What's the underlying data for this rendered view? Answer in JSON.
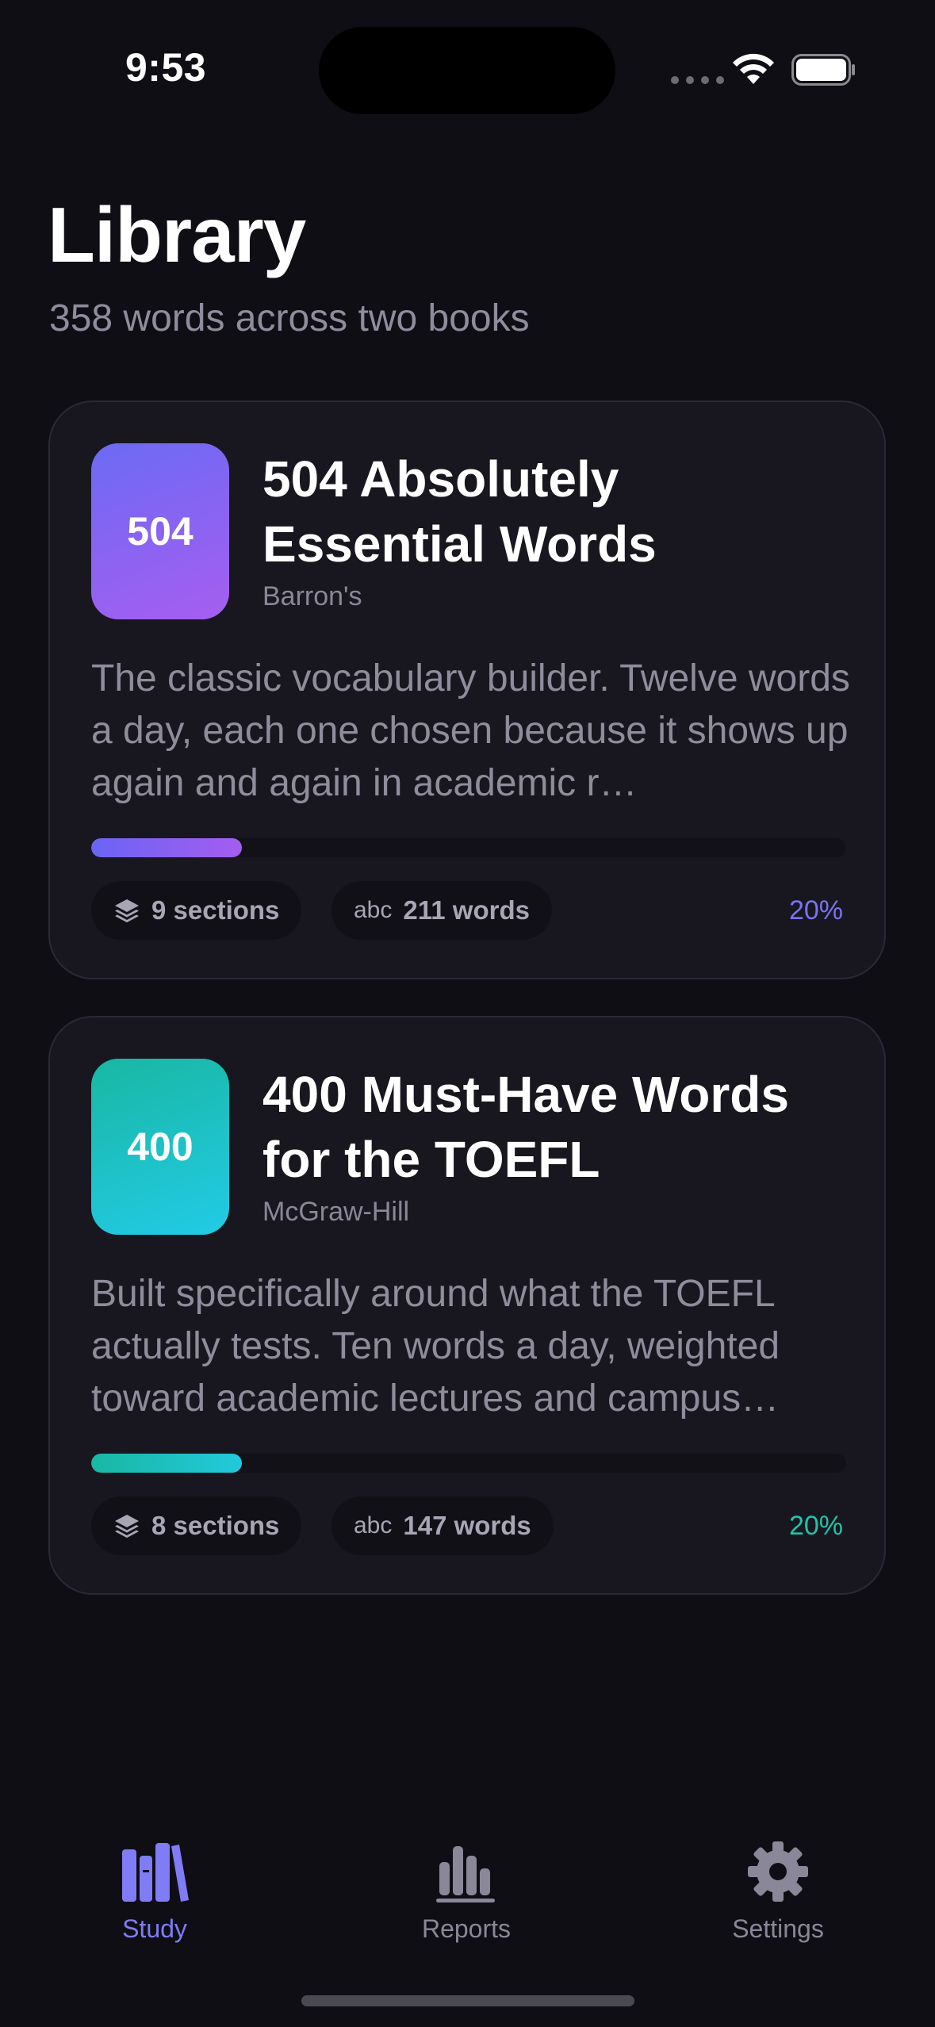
{
  "status_bar": {
    "time": "9:53"
  },
  "header": {
    "title": "Library",
    "subtitle": "358 words across two books"
  },
  "books": [
    {
      "cover_label": "504",
      "title": "504 Absolutely Essential Words",
      "publisher": "Barron's",
      "description": "The classic vocabulary builder. Twelve words a day, each one chosen because it shows up again and again in academic r…",
      "progress": 0.2,
      "progress_label": "20%",
      "sections_label": "9 sections",
      "words_prefix": "abc",
      "words_label": "211 words",
      "accent": "#7b72f5"
    },
    {
      "cover_label": "400",
      "title": "400 Must-Have Words for the TOEFL",
      "publisher": "McGraw-Hill",
      "description": "Built specifically around what the TOEFL actually tests. Ten words a day, weighted toward academic lectures and campus…",
      "progress": 0.2,
      "progress_label": "20%",
      "sections_label": "8 sections",
      "words_prefix": "abc",
      "words_label": "147 words",
      "accent": "#22c3a8"
    }
  ],
  "tab_bar": {
    "items": [
      {
        "label": "Study",
        "icon": "books-icon",
        "active": true
      },
      {
        "label": "Reports",
        "icon": "bar-chart-icon",
        "active": false
      },
      {
        "label": "Settings",
        "icon": "gear-icon",
        "active": false
      }
    ]
  },
  "colors": {
    "background": "#0f0e15",
    "card": "#18171f",
    "tab_active": "#7f7cf6",
    "tab_inactive": "#8a8798"
  }
}
